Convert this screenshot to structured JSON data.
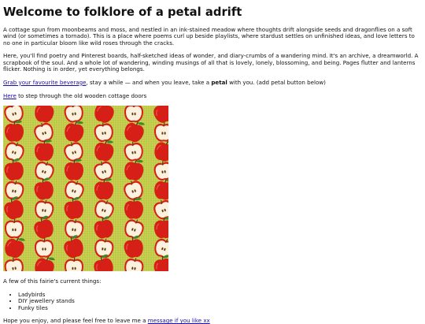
{
  "page": {
    "title": "Welcome to folklore of a petal adrift",
    "intro": "A cottage spun from moonbeams and moss, and nestled in an ink-stained meadow where thoughts drift alongside seeds and dragonflies on a soft wind (or sometimes a tornado). This is a place where poems curl up beside playlists, where stardust settles on unfinished ideas, and love letters to no one in particular bloom like wild roses through the cracks.",
    "description": "Here, you'll find poetry and Pinterest boards, half-sketched ideas of wonder, and diary-crumbs of a wandering mind. It's an archive, a dreamworld. A scrapbook of the soul. And a whole lot of wandering, winding musings of all that is lovely, lonely, blossoming, and being. Pages flutter and lanterns flicker. Nothing is in order, yet everything belongs.",
    "beverage_link": "Grab your favourite beverage",
    "beverage_text_1": ", stay a while — and when you leave, take a ",
    "beverage_bold": "petal",
    "beverage_text_2": " with you. (add petal button below)",
    "here_link": "Here",
    "here_text": " to step through the old wooden cottage doors",
    "things_heading": "A few of this fairie's current things:",
    "things": [
      "Ladybirds",
      "DIY jewellery stands",
      "Funky tiles"
    ],
    "footer_text": "Hope you enjoy, and please feel free to leave me a ",
    "footer_link": "message if you like xx"
  },
  "pattern": {
    "background": "#c2cc4a",
    "apple_red": "#d51f17",
    "apple_half_flesh": "#fbf1dc",
    "leaf_green": "#3c8a2c",
    "stem_brown": "#5b3a1a"
  }
}
